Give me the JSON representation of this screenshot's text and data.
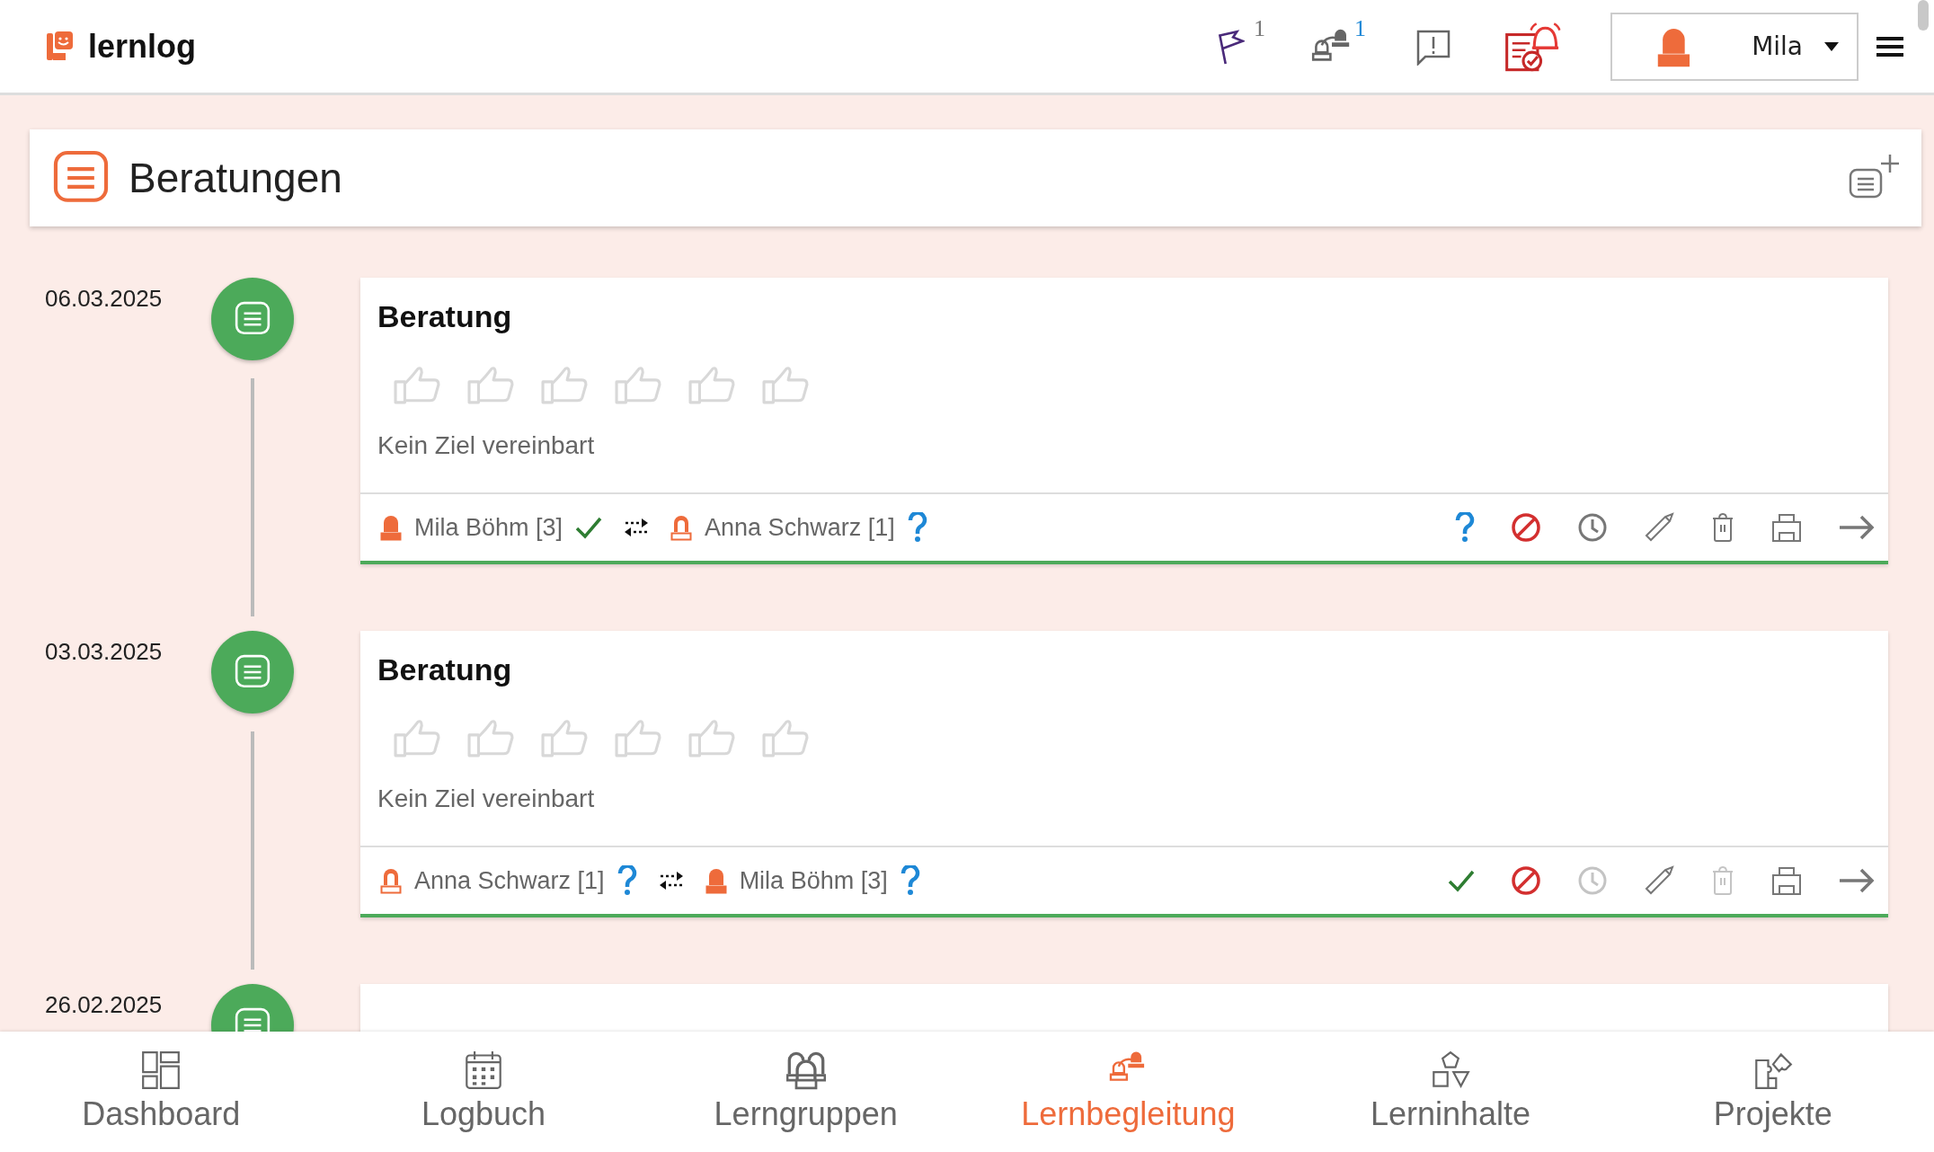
{
  "app": {
    "name": "lernlog"
  },
  "toolbar": {
    "items": [
      {
        "kind": "flag",
        "badge": "1"
      },
      {
        "kind": "exchange",
        "badge": "1"
      },
      {
        "kind": "message"
      },
      {
        "kind": "alarm"
      }
    ],
    "user": {
      "name": "Mila"
    }
  },
  "page": {
    "title": "Beratungen"
  },
  "entries": [
    {
      "date": "06.03.2025",
      "title": "Beratung",
      "stars": 0,
      "goal": "Kein Ziel vereinbart",
      "participants": [
        {
          "name": "Mila Böhm [3]",
          "filled": true,
          "confirmed": true
        },
        {
          "name": "Anna Schwarz [1]",
          "filled": false,
          "confirmed": false
        }
      ],
      "confirmed": false,
      "history_disabled": false,
      "delete_disabled": false
    },
    {
      "date": "03.03.2025",
      "title": "Beratung",
      "stars": 0,
      "goal": "Kein Ziel vereinbart",
      "participants": [
        {
          "name": "Anna Schwarz [1]",
          "filled": false,
          "confirmed": false
        },
        {
          "name": "Mila Böhm [3]",
          "filled": true,
          "confirmed": false
        }
      ],
      "confirmed": true,
      "history_disabled": true,
      "delete_disabled": true
    },
    {
      "date": "26.02.2025"
    }
  ],
  "bottom_nav": [
    {
      "kind": "dashboard",
      "label": "Dashboard",
      "selected": false
    },
    {
      "kind": "calendar",
      "label": "Logbuch",
      "selected": false
    },
    {
      "kind": "group",
      "label": "Lerngruppen",
      "selected": false
    },
    {
      "kind": "exchange",
      "label": "Lernbegleitung",
      "selected": true
    },
    {
      "kind": "shapes",
      "label": "Lerninhalte",
      "selected": false
    },
    {
      "kind": "puzzle",
      "label": "Projekte",
      "selected": false
    }
  ]
}
